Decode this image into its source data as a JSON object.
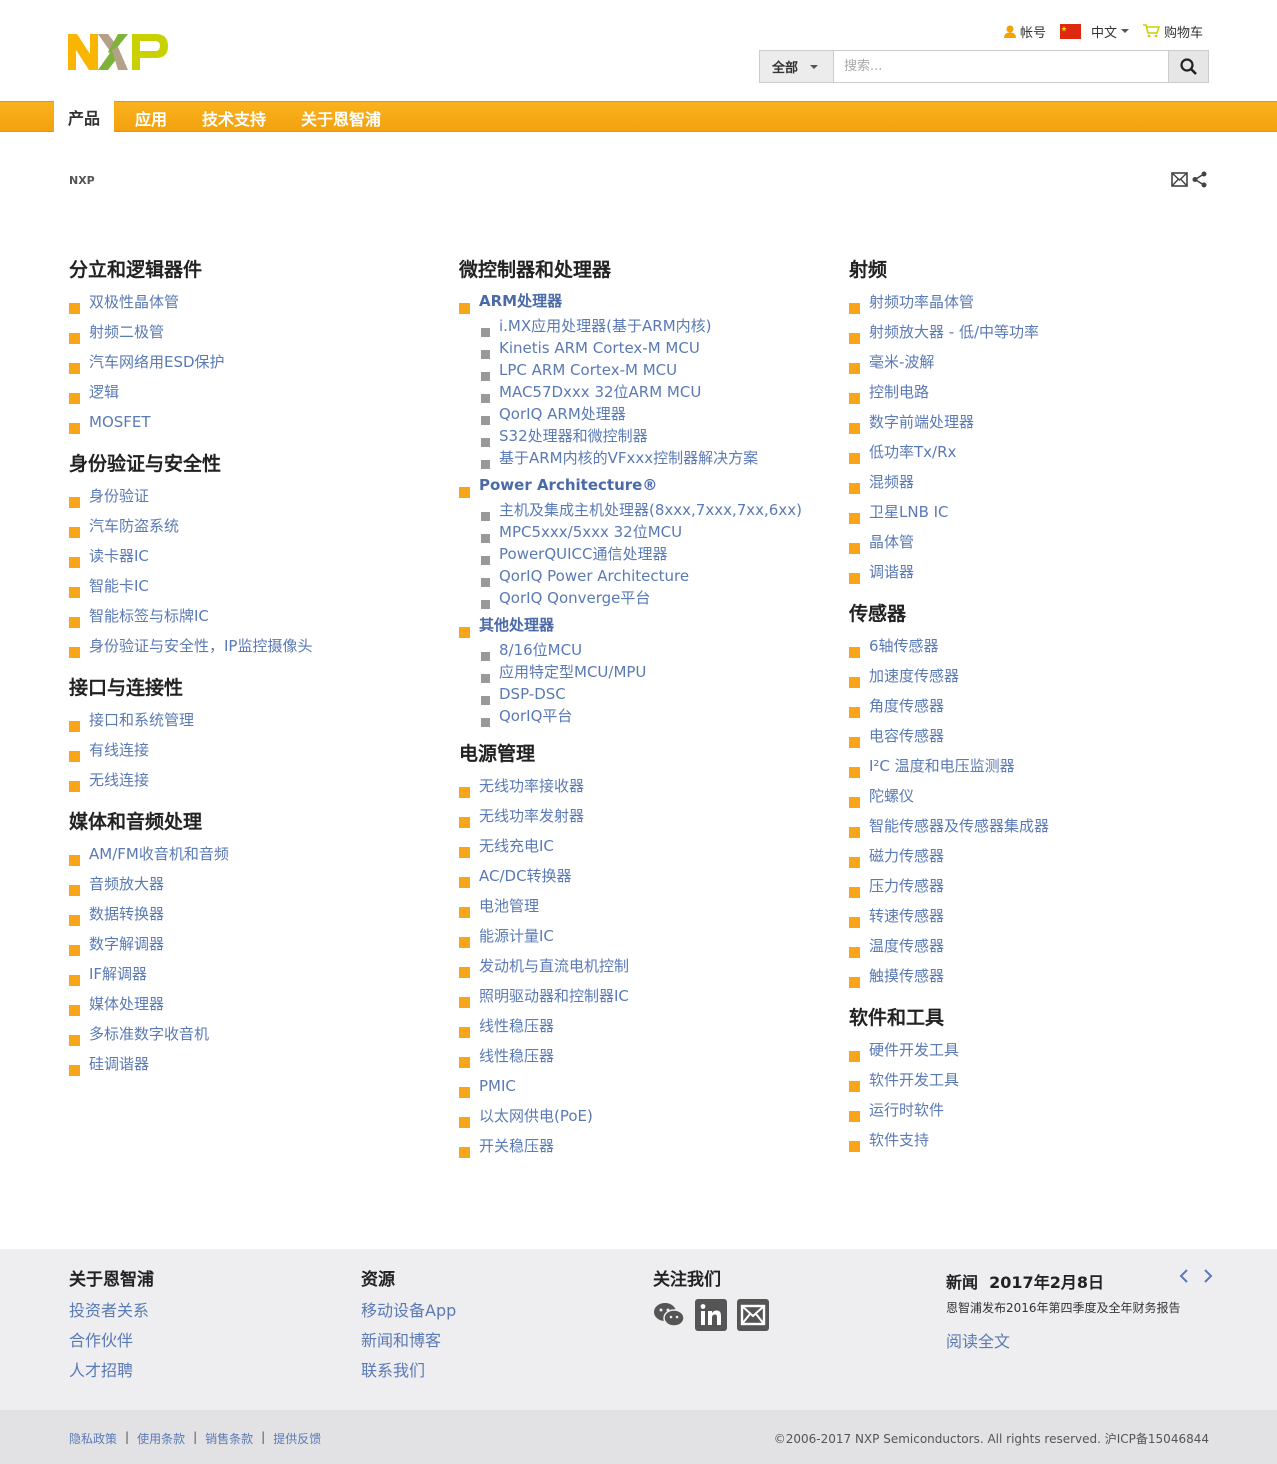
{
  "header": {
    "logo_text": "NXP",
    "account_label": "帐号",
    "language_label": "中文",
    "cart_label": "购物车",
    "search": {
      "scope_label": "全部",
      "placeholder": "搜索..."
    }
  },
  "nav": {
    "tabs": [
      "产品",
      "应用",
      "技术支持",
      "关于恩智浦"
    ],
    "active": "产品"
  },
  "breadcrumb": "NXP",
  "columns": [
    [
      {
        "title": "分立和逻辑器件",
        "items": [
          "双极性晶体管",
          "射频二极管",
          "汽车网络用ESD保护",
          "逻辑",
          "MOSFET"
        ]
      },
      {
        "title": "身份验证与安全性",
        "items": [
          "身份验证",
          "汽车防盗系统",
          "读卡器IC",
          "智能卡IC",
          "智能标签与标牌IC",
          "身份验证与安全性，IP监控摄像头"
        ]
      },
      {
        "title": "接口与连接性",
        "items": [
          "接口和系统管理",
          "有线连接",
          "无线连接"
        ]
      },
      {
        "title": "媒体和音频处理",
        "items": [
          "AM/FM收音机和音频",
          "音频放大器",
          "数据转换器",
          "数字解调器",
          "IF解调器",
          "媒体处理器",
          "多标准数字收音机",
          "硅调谐器"
        ]
      }
    ],
    [
      {
        "title": "微控制器和处理器",
        "groups": [
          {
            "label": "ARM处理器",
            "items": [
              "i.MX应用处理器(基于ARM内核)",
              "Kinetis ARM Cortex-M MCU",
              "LPC ARM Cortex-M MCU",
              "MAC57Dxxx 32位ARM MCU",
              "QorIQ ARM处理器",
              "S32处理器和微控制器",
              "基于ARM内核的VFxxx控制器解决方案"
            ]
          },
          {
            "label": "Power Architecture®",
            "items": [
              "主机及集成主机处理器(8xxx,7xxx,7xx,6xx)",
              "MPC5xxx/5xxx 32位MCU",
              "PowerQUICC通信处理器",
              "QorIQ Power Architecture",
              "QorIQ Qonverge平台"
            ]
          },
          {
            "label": "其他处理器",
            "items": [
              "8/16位MCU",
              "应用特定型MCU/MPU",
              "DSP-DSC",
              "QorIQ平台"
            ]
          }
        ]
      },
      {
        "title": "电源管理",
        "items": [
          "无线功率接收器",
          "无线功率发射器",
          "无线充电IC",
          "AC/DC转换器",
          "电池管理",
          "能源计量IC",
          "发动机与直流电机控制",
          "照明驱动器和控制器IC",
          "线性稳压器",
          "线性稳压器",
          "PMIC",
          "以太网供电(PoE)",
          "开关稳压器"
        ]
      }
    ],
    [
      {
        "title": "射频",
        "items": [
          "射频功率晶体管",
          "射频放大器 - 低/中等功率",
          "毫米-波解",
          "控制电路",
          "数字前端处理器",
          "低功率Tx/Rx",
          "混频器",
          "卫星LNB IC",
          "晶体管",
          "调谐器"
        ]
      },
      {
        "title": "传感器",
        "items": [
          "6轴传感器",
          "加速度传感器",
          "角度传感器",
          "电容传感器",
          "I²C 温度和电压监测器",
          "陀螺仪",
          "智能传感器及传感器集成器",
          "磁力传感器",
          "压力传感器",
          "转速传感器",
          "温度传感器",
          "触摸传感器"
        ]
      },
      {
        "title": "软件和工具",
        "items": [
          "硬件开发工具",
          "软件开发工具",
          "运行时软件",
          "软件支持"
        ]
      }
    ]
  ],
  "footer": {
    "about": {
      "title": "关于恩智浦",
      "links": [
        "投资者关系",
        "合作伙伴",
        "人才招聘"
      ]
    },
    "resources": {
      "title": "资源",
      "links": [
        "移动设备App",
        "新闻和博客",
        "联系我们"
      ]
    },
    "follow": {
      "title": "关注我们"
    },
    "news": {
      "title": "新闻",
      "date": "2017年2月8日",
      "text": "恩智浦发布2016年第四季度及全年财务报告",
      "link": "阅读全文"
    },
    "legal_links": [
      "隐私政策",
      "使用条款",
      "销售条款",
      "提供反馈"
    ],
    "copyright": "©2006-2017 NXP Semiconductors. All rights reserved. 沪ICP备15046844"
  },
  "colors": {
    "accent": "#f9a51a",
    "link": "#5a7ab5"
  }
}
